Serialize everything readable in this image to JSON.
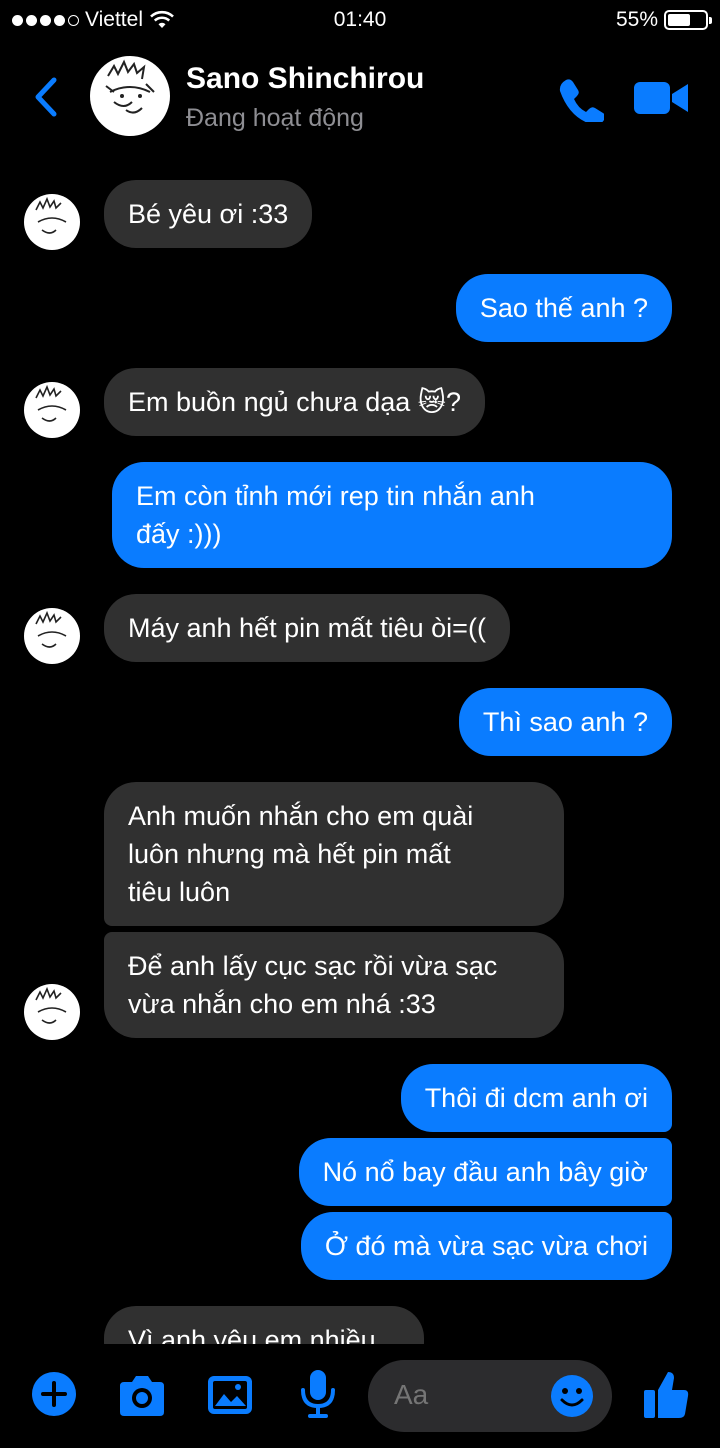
{
  "status_bar": {
    "carrier": "Viettel",
    "time": "01:40",
    "battery": "55%",
    "battery_level": 0.55
  },
  "header": {
    "name": "Sano Shinchirou",
    "status": "Đang hoạt động"
  },
  "messages": [
    {
      "from": "them",
      "text": "Bé yêu ơi :33"
    },
    {
      "from": "me",
      "text": "Sao thế anh ?"
    },
    {
      "from": "them",
      "text": "Em buồn ngủ chưa dạa",
      "emoji": "😿",
      "suffix": "?"
    },
    {
      "from": "me",
      "text": "Em còn tỉnh mới rep tin nhắn anh\nđấy :)))"
    },
    {
      "from": "them",
      "text": "Máy anh hết pin mất tiêu òi=(("
    },
    {
      "from": "me",
      "text": "Thì sao anh ?"
    },
    {
      "from": "them",
      "text": "Anh muốn nhắn cho em quài\nluôn nhưng mà hết pin mất\ntiêu luôn"
    },
    {
      "from": "them",
      "text": "Để anh lấy cục sạc rồi vừa sạc\nvừa nhắn cho em nhá :33"
    },
    {
      "from": "me",
      "text": "Thôi đi dcm anh ơi"
    },
    {
      "from": "me",
      "text": "Nó nổ bay đầu anh bây giờ"
    },
    {
      "from": "me",
      "text": "Ở đó mà vừa sạc vừa chơi"
    },
    {
      "from": "them",
      "text": "Vì anh yêu em nhiều"
    }
  ],
  "composer": {
    "placeholder": "Aa"
  },
  "colors": {
    "accent": "#0a7cff",
    "incoming_bubble": "#303030",
    "background": "#000000"
  },
  "icons": [
    "back-chevron-icon",
    "phone-icon",
    "video-camera-icon",
    "plus-icon",
    "camera-icon",
    "image-icon",
    "microphone-icon",
    "emoji-icon",
    "thumbs-up-icon"
  ]
}
